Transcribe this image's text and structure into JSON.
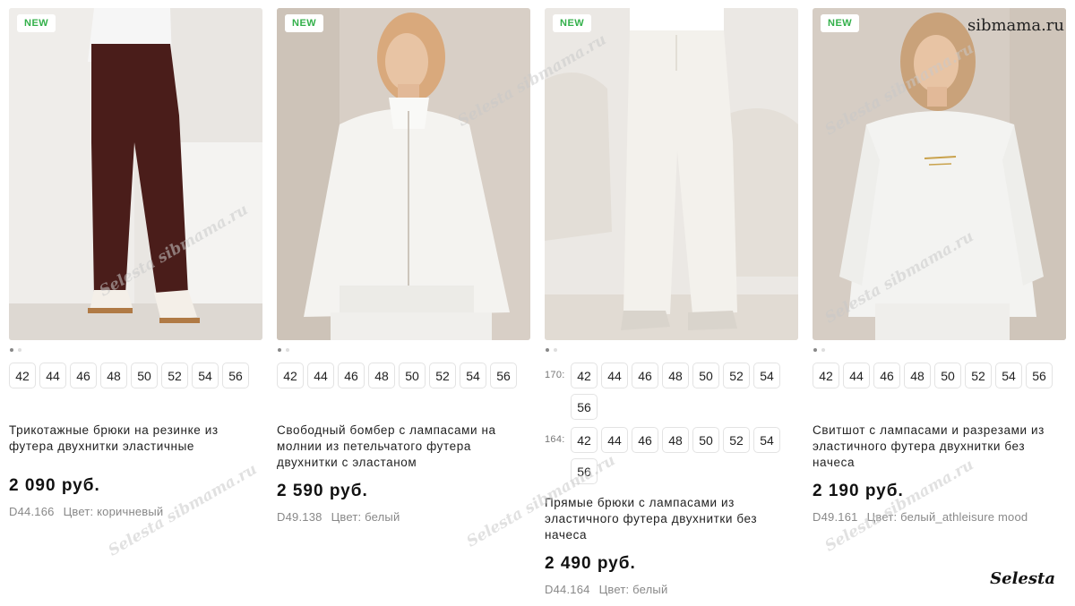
{
  "watermark_text": "Selesta sibmama.ru",
  "site_stamp": "sibmama.ru",
  "signature": "Selesta",
  "badge_color": "#33b04a",
  "products": [
    {
      "badge": "NEW",
      "photo": "brown-jersey-trousers-photo",
      "sizes": [
        "42",
        "44",
        "46",
        "48",
        "50",
        "52",
        "54",
        "56"
      ],
      "title": "Трикотажные брюки на резинке из футера двухнитки эластичные",
      "price": "2 090 руб.",
      "article": "D44.166",
      "color": "Цвет: коричневый"
    },
    {
      "badge": "NEW",
      "photo": "white-zip-bomber-photo",
      "sizes": [
        "42",
        "44",
        "46",
        "48",
        "50",
        "52",
        "54",
        "56"
      ],
      "title": "Свободный бомбер с лампасами на молнии из петельчатого футера двухнитки с эластаном",
      "price": "2 590 руб.",
      "article": "D49.138",
      "color": "Цвет: белый"
    },
    {
      "badge": "NEW",
      "photo": "white-straight-trousers-photo",
      "height_groups": [
        {
          "label": "170:",
          "sizes": [
            "42",
            "44",
            "46",
            "48",
            "50",
            "52",
            "54",
            "56"
          ]
        },
        {
          "label": "164:",
          "sizes": [
            "42",
            "44",
            "46",
            "48",
            "50",
            "52",
            "54",
            "56"
          ]
        }
      ],
      "title": "Прямые брюки с лампасами из эластичного футера двухнитки без начеса",
      "price": "2 490 руб.",
      "article": "D44.164",
      "color": "Цвет: белый"
    },
    {
      "badge": "NEW",
      "photo": "white-sweatshirt-photo",
      "sizes": [
        "42",
        "44",
        "46",
        "48",
        "50",
        "52",
        "54",
        "56"
      ],
      "title": "Свитшот с лампасами и разрезами из эластичного футера двухнитки без начеса",
      "price": "2 190 руб.",
      "article": "D49.161",
      "color": "Цвет: белый_athleisure mood"
    }
  ]
}
